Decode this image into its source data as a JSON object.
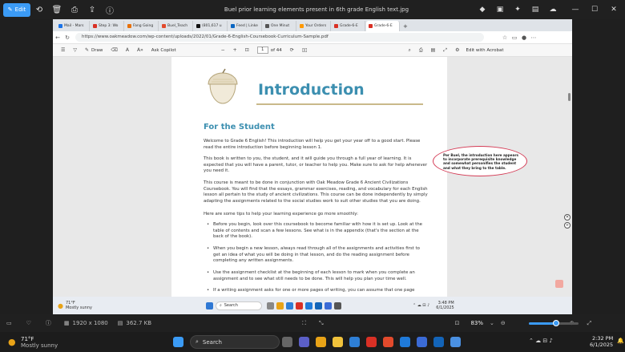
{
  "viewer": {
    "edit_label": "Edit",
    "title": "Buel prior learning elements present in 6th grade English text.jpg",
    "image_size": "1920 x 1080",
    "file_size": "362.7 KB",
    "zoom": "83%",
    "zoom_fraction": 0.55
  },
  "browser": {
    "tabs": [
      {
        "label": "Mail - Mars",
        "color": "#1a73e8"
      },
      {
        "label": "Step 3: Wo",
        "color": "#d93025"
      },
      {
        "label": "Fang Going",
        "color": "#e8710a"
      },
      {
        "label": "Buel_Teach",
        "color": "#e24a2c"
      },
      {
        "label": "(801,617 u",
        "color": "#111111"
      },
      {
        "label": "Feed | Linke",
        "color": "#0a66c2"
      },
      {
        "label": "One Minut",
        "color": "#555555"
      },
      {
        "label": "Your Orders",
        "color": "#ff9900"
      },
      {
        "label": "Grade-6-E",
        "color": "#d93025"
      },
      {
        "label": "Grade-6-E",
        "color": "#d93025",
        "active": true
      }
    ],
    "url": "https://www.oakmeadow.com/wp-content/uploads/2022/01/Grade-6-English-Coursebook-Curriculum-Sample.pdf"
  },
  "pdf_toolbar": {
    "draw_label": "Draw",
    "copilot_label": "Ask Copilot",
    "page_current": "1",
    "page_total": "of 44",
    "acrobat_label": "Edit with Acrobat"
  },
  "document": {
    "title": "Introduction",
    "heading": "For the Student",
    "paragraphs": [
      "Welcome to Grade 6 English! This introduction will help you get your year off to a good start. Please read the entire introduction before beginning lesson 1.",
      "This book is written to you, the student, and it will guide you through a full year of learning. It is expected that you will have a parent, tutor, or teacher to help you. Make sure to ask for help whenever you need it.",
      "This course is meant to be done in conjunction with Oak Meadow Grade 6 Ancient Civilizations Coursebook. You will find that the essays, grammar exercises, reading, and vocabulary for each English lesson all pertain to the study of ancient civilizations. This course can be done independently by simply adapting the assignments related to the social studies work to suit other studies that you are doing.",
      "Here are some tips to help your learning experience go more smoothly:"
    ],
    "bullets": [
      "Before you begin, look over this coursebook to become familiar with how it is set up. Look at the table of contents and scan a few lessons. See what is in the appendix (that's the section at the back of the book).",
      "When you begin a new lesson, always read through all of the assignments and activities first to get an idea of what you will be doing in that lesson, and do the reading assignment before completing any written assignments.",
      "Use the assignment checklist at the beginning of each lesson to mark when you complete an assignment and to see what still needs to be done. This will help you plan your time well.",
      "If a writing assignment asks for one or more pages of writing, you can assume that one page"
    ]
  },
  "annotation": "Per Buel, the introduction here appears to incorporate prerequisite knowledge and somewhat personifies the student and what they bring to the table.",
  "inner_taskbar": {
    "weather_temp": "71°F",
    "weather_desc": "Mostly sunny",
    "search_label": "Search",
    "time": "3:48 PM",
    "date": "6/1/2025"
  },
  "taskbar": {
    "weather_temp": "71°F",
    "weather_desc": "Mostly sunny",
    "search_label": "Search",
    "time": "2:32 PM",
    "date": "6/1/2025"
  },
  "colors": {
    "accent": "#3b9bf5",
    "title_teal": "#3c8fb0",
    "annotation_border": "#d43b55"
  }
}
